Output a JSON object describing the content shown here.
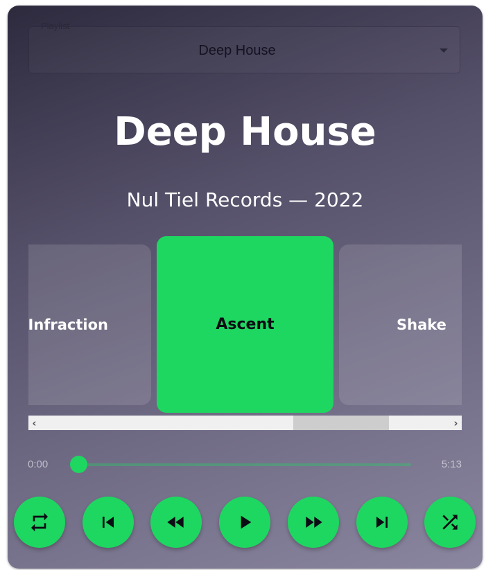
{
  "playlist": {
    "label": "Playlist",
    "selected": "Deep House"
  },
  "album": {
    "title": "Deep House",
    "subtitle": "Nul Tiel Records — 2022"
  },
  "tracks": {
    "previous": "Infraction",
    "current": "Ascent",
    "next": "Shake"
  },
  "progress": {
    "current_time": "0:00",
    "total_time": "5:13",
    "fraction": 0.0
  },
  "controls": [
    "repeat-icon",
    "skip-previous-icon",
    "rewind-icon",
    "play-icon",
    "fast-forward-icon",
    "skip-next-icon",
    "shuffle-icon"
  ],
  "colors": {
    "accent": "#1ed760",
    "card_inactive": "rgba(255,255,255,0.12)",
    "icon": "#0c0c14"
  }
}
